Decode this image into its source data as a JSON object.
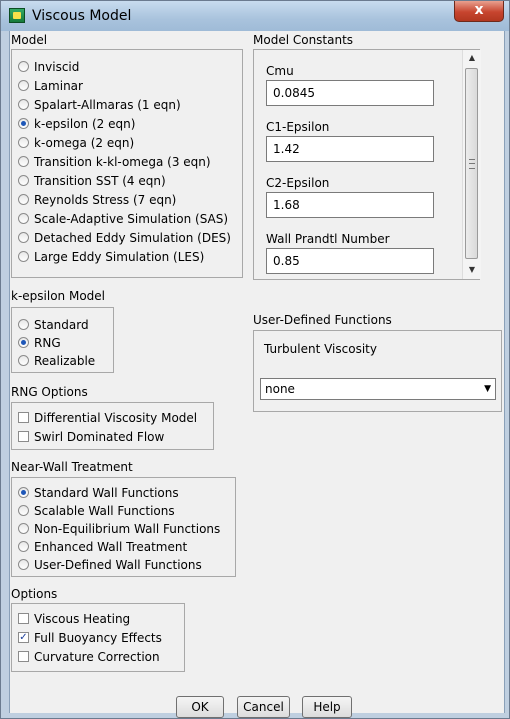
{
  "window": {
    "title": "Viscous Model",
    "close_label": "x"
  },
  "model": {
    "label": "Model",
    "options": [
      {
        "label": "Inviscid",
        "selected": false
      },
      {
        "label": "Laminar",
        "selected": false
      },
      {
        "label": "Spalart-Allmaras (1 eqn)",
        "selected": false
      },
      {
        "label": "k-epsilon (2 eqn)",
        "selected": true
      },
      {
        "label": "k-omega (2 eqn)",
        "selected": false
      },
      {
        "label": "Transition k-kl-omega (3 eqn)",
        "selected": false
      },
      {
        "label": "Transition SST (4 eqn)",
        "selected": false
      },
      {
        "label": "Reynolds Stress (7 eqn)",
        "selected": false
      },
      {
        "label": "Scale-Adaptive Simulation (SAS)",
        "selected": false
      },
      {
        "label": "Detached Eddy Simulation (DES)",
        "selected": false
      },
      {
        "label": "Large Eddy Simulation (LES)",
        "selected": false
      }
    ]
  },
  "kepsilon": {
    "label": "k-epsilon Model",
    "options": [
      {
        "label": "Standard",
        "selected": false
      },
      {
        "label": "RNG",
        "selected": true
      },
      {
        "label": "Realizable",
        "selected": false
      }
    ]
  },
  "rng": {
    "label": "RNG Options",
    "options": [
      {
        "label": "Differential Viscosity Model",
        "checked": false
      },
      {
        "label": "Swirl Dominated Flow",
        "checked": false
      }
    ]
  },
  "nearwall": {
    "label": "Near-Wall Treatment",
    "options": [
      {
        "label": "Standard Wall Functions",
        "selected": true
      },
      {
        "label": "Scalable Wall Functions",
        "selected": false
      },
      {
        "label": "Non-Equilibrium Wall Functions",
        "selected": false
      },
      {
        "label": "Enhanced Wall Treatment",
        "selected": false
      },
      {
        "label": "User-Defined Wall Functions",
        "selected": false
      }
    ]
  },
  "options": {
    "label": "Options",
    "items": [
      {
        "label": "Viscous Heating",
        "checked": false
      },
      {
        "label": "Full Buoyancy Effects",
        "checked": true
      },
      {
        "label": "Curvature Correction",
        "checked": false
      }
    ]
  },
  "constants": {
    "label": "Model Constants",
    "items": [
      {
        "label": "Cmu",
        "value": "0.0845"
      },
      {
        "label": "C1-Epsilon",
        "value": "1.42"
      },
      {
        "label": "C2-Epsilon",
        "value": "1.68"
      },
      {
        "label": "Wall Prandtl Number",
        "value": "0.85"
      }
    ]
  },
  "udf": {
    "label": "User-Defined Functions",
    "turbulent_label": "Turbulent Viscosity",
    "turbulent_value": "none"
  },
  "buttons": {
    "ok": "OK",
    "cancel": "Cancel",
    "help": "Help"
  }
}
